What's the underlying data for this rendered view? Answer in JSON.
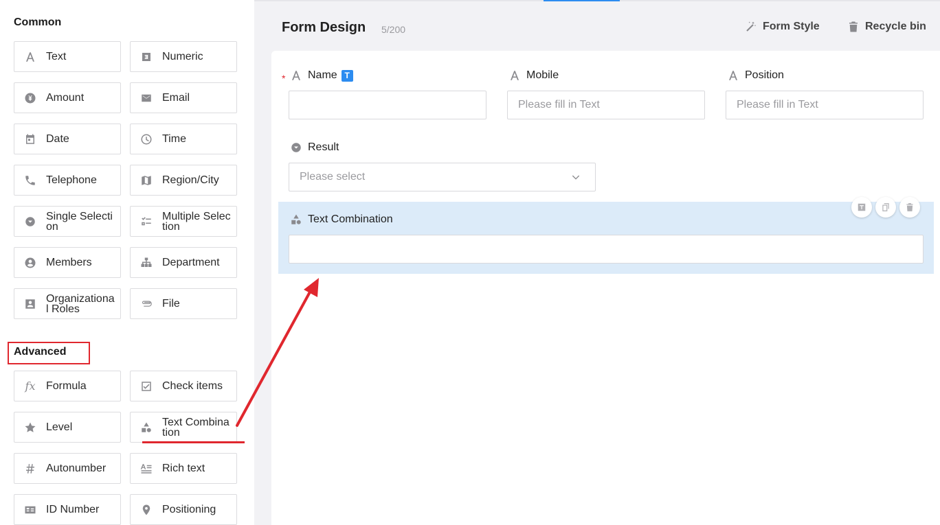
{
  "header": {
    "title": "Form Design",
    "count": "5/200",
    "form_style": "Form Style",
    "recycle_bin": "Recycle bin"
  },
  "sidebar": {
    "common_title": "Common",
    "advanced_title": "Advanced",
    "common": [
      {
        "label": "Text",
        "icon": "text-icon"
      },
      {
        "label": "Numeric",
        "icon": "numeric-icon"
      },
      {
        "label": "Amount",
        "icon": "amount-icon"
      },
      {
        "label": "Email",
        "icon": "email-icon"
      },
      {
        "label": "Date",
        "icon": "date-icon"
      },
      {
        "label": "Time",
        "icon": "time-icon"
      },
      {
        "label": "Telephone",
        "icon": "telephone-icon"
      },
      {
        "label": "Region/City",
        "icon": "map-icon"
      },
      {
        "label": "Single Selection",
        "icon": "single-selection-icon"
      },
      {
        "label": "Multiple Selection",
        "icon": "multiple-selection-icon"
      },
      {
        "label": "Members",
        "icon": "members-icon"
      },
      {
        "label": "Department",
        "icon": "department-icon"
      },
      {
        "label": "Organizational Roles",
        "icon": "roles-icon"
      },
      {
        "label": "File",
        "icon": "file-icon"
      }
    ],
    "advanced": [
      {
        "label": "Formula",
        "icon": "formula-icon"
      },
      {
        "label": "Check items",
        "icon": "check-items-icon"
      },
      {
        "label": "Level",
        "icon": "star-icon"
      },
      {
        "label": "Text Combination",
        "icon": "text-combination-icon"
      },
      {
        "label": "Autonumber",
        "icon": "hash-icon"
      },
      {
        "label": "Rich text",
        "icon": "rich-text-icon"
      },
      {
        "label": "ID Number",
        "icon": "id-card-icon"
      },
      {
        "label": "Positioning",
        "icon": "location-icon"
      }
    ]
  },
  "form": {
    "name_label": "Name",
    "name_badge": "T",
    "required_mark": "*",
    "mobile_label": "Mobile",
    "mobile_placeholder": "Please fill in Text",
    "position_label": "Position",
    "position_placeholder": "Please fill in Text",
    "result_label": "Result",
    "result_placeholder": "Please select",
    "text_combination_label": "Text Combination"
  },
  "colors": {
    "accent": "#2d8cf0",
    "annotation_red": "#e0272e",
    "selected_bg": "#dcebf9"
  }
}
